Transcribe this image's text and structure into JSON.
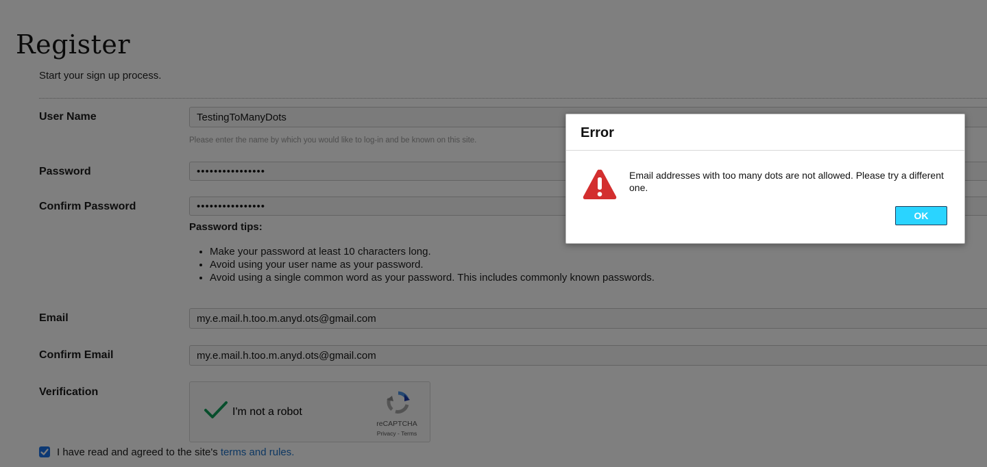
{
  "page": {
    "title": "Register",
    "intro": "Start your sign up process."
  },
  "form": {
    "username": {
      "label": "User Name",
      "value": "TestingToManyDots",
      "hint": "Please enter the name by which you would like to log-in and be known on this site."
    },
    "password": {
      "label": "Password",
      "value": "••••••••••••••••"
    },
    "confirm_password": {
      "label": "Confirm Password",
      "value": "••••••••••••••••"
    },
    "password_tips": {
      "title": "Password tips:",
      "items": [
        "Make your password at least 10 characters long.",
        "Avoid using your user name as your password.",
        "Avoid using a single common word as your password. This includes commonly known passwords."
      ]
    },
    "email": {
      "label": "Email",
      "value": "my.e.mail.h.too.m.anyd.ots@gmail.com"
    },
    "confirm_email": {
      "label": "Confirm Email",
      "value": "my.e.mail.h.too.m.anyd.ots@gmail.com"
    },
    "verification": {
      "label": "Verification",
      "checkbox_label": "I'm not a robot",
      "brand": "reCAPTCHA",
      "links": "Privacy - Terms",
      "checked": true
    },
    "agreement": {
      "text": "I have read and agreed to the site's",
      "link_text": "terms and rules.",
      "checked": true
    }
  },
  "dialog": {
    "title": "Error",
    "message": "Email addresses with too many dots are not allowed. Please try a different one.",
    "ok_label": "OK",
    "icon": "warning-icon"
  },
  "colors": {
    "overlay": "rgba(0,0,0,0.5)",
    "ok_button": "#2ad4ff",
    "link": "#1a6fc4",
    "checkbox": "#1a73e8",
    "warning": "#d32f2f",
    "recaptcha_check": "#0f9d58"
  }
}
